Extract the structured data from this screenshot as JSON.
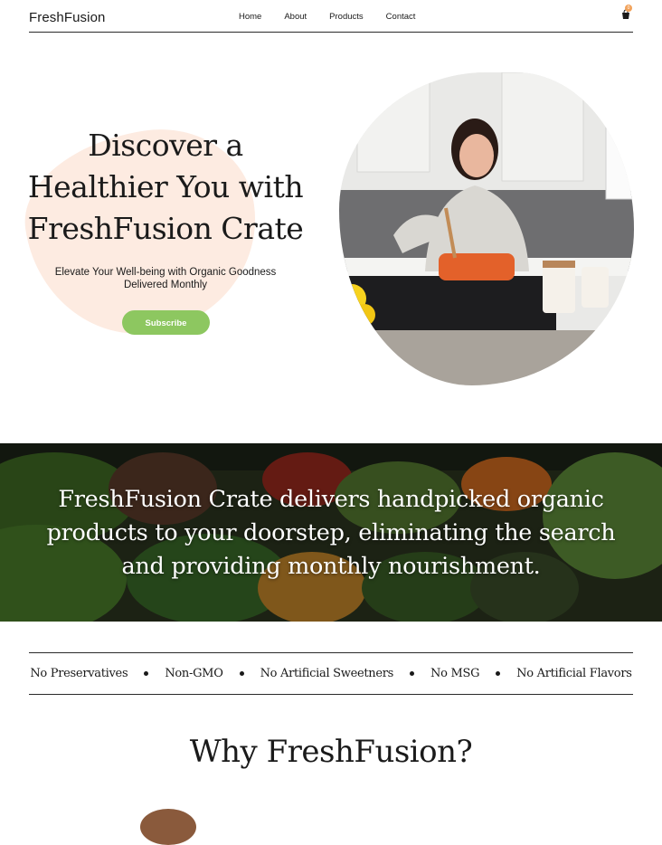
{
  "header": {
    "brand": "FreshFusion",
    "nav": [
      "Home",
      "About",
      "Products",
      "Contact"
    ],
    "cart_count": "0"
  },
  "hero": {
    "title": "Discover a Healthier You with FreshFusion Crate",
    "subtitle": "Elevate Your Well-being with Organic Goodness Delivered Monthly",
    "cta": "Subscribe"
  },
  "banner": {
    "text": "FreshFusion Crate delivers handpicked organic products to your doorstep,  eliminating the search and providing monthly nourishment."
  },
  "features": [
    "No Preservatives",
    "Non-GMO",
    "No Artificial Sweetners",
    "No MSG",
    "No Artificial Flavors"
  ],
  "why": {
    "title": "Why FreshFusion?"
  },
  "colors": {
    "accent": "#8dc760",
    "blob": "#fdebe1",
    "badge": "#f2a25a"
  }
}
